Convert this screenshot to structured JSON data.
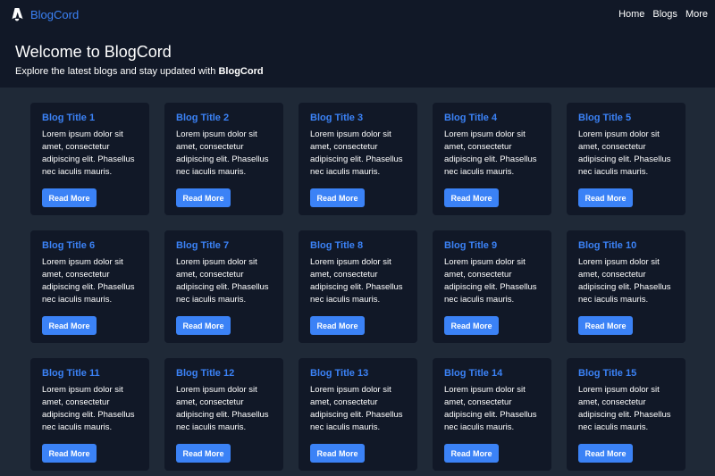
{
  "nav": {
    "brand": "BlogCord",
    "links": [
      "Home",
      "Blogs",
      "More"
    ]
  },
  "hero": {
    "title": "Welcome to BlogCord",
    "subtitle_prefix": "Explore the latest blogs and stay updated with ",
    "subtitle_brand": "BlogCord"
  },
  "cards": [
    {
      "title": "Blog Title 1",
      "excerpt": "Lorem ipsum dolor sit amet, consectetur adipiscing elit. Phasellus nec iaculis mauris.",
      "button": "Read More"
    },
    {
      "title": "Blog Title 2",
      "excerpt": "Lorem ipsum dolor sit amet, consectetur adipiscing elit. Phasellus nec iaculis mauris.",
      "button": "Read More"
    },
    {
      "title": "Blog Title 3",
      "excerpt": "Lorem ipsum dolor sit amet, consectetur adipiscing elit. Phasellus nec iaculis mauris.",
      "button": "Read More"
    },
    {
      "title": "Blog Title 4",
      "excerpt": "Lorem ipsum dolor sit amet, consectetur adipiscing elit. Phasellus nec iaculis mauris.",
      "button": "Read More"
    },
    {
      "title": "Blog Title 5",
      "excerpt": "Lorem ipsum dolor sit amet, consectetur adipiscing elit. Phasellus nec iaculis mauris.",
      "button": "Read More"
    },
    {
      "title": "Blog Title 6",
      "excerpt": "Lorem ipsum dolor sit amet, consectetur adipiscing elit. Phasellus nec iaculis mauris.",
      "button": "Read More"
    },
    {
      "title": "Blog Title 7",
      "excerpt": "Lorem ipsum dolor sit amet, consectetur adipiscing elit. Phasellus nec iaculis mauris.",
      "button": "Read More"
    },
    {
      "title": "Blog Title 8",
      "excerpt": "Lorem ipsum dolor sit amet, consectetur adipiscing elit. Phasellus nec iaculis mauris.",
      "button": "Read More"
    },
    {
      "title": "Blog Title 9",
      "excerpt": "Lorem ipsum dolor sit amet, consectetur adipiscing elit. Phasellus nec iaculis mauris.",
      "button": "Read More"
    },
    {
      "title": "Blog Title 10",
      "excerpt": "Lorem ipsum dolor sit amet, consectetur adipiscing elit. Phasellus nec iaculis mauris.",
      "button": "Read More"
    },
    {
      "title": "Blog Title 11",
      "excerpt": "Lorem ipsum dolor sit amet, consectetur adipiscing elit. Phasellus nec iaculis mauris.",
      "button": "Read More"
    },
    {
      "title": "Blog Title 12",
      "excerpt": "Lorem ipsum dolor sit amet, consectetur adipiscing elit. Phasellus nec iaculis mauris.",
      "button": "Read More"
    },
    {
      "title": "Blog Title 13",
      "excerpt": "Lorem ipsum dolor sit amet, consectetur adipiscing elit. Phasellus nec iaculis mauris.",
      "button": "Read More"
    },
    {
      "title": "Blog Title 14",
      "excerpt": "Lorem ipsum dolor sit amet, consectetur adipiscing elit. Phasellus nec iaculis mauris.",
      "button": "Read More"
    },
    {
      "title": "Blog Title 15",
      "excerpt": "Lorem ipsum dolor sit amet, consectetur adipiscing elit. Phasellus nec iaculis mauris.",
      "button": "Read More"
    }
  ],
  "theme": {
    "accent": "#3b82f6",
    "header_bg": "#111827",
    "page_bg": "#1f2937",
    "card_bg": "#111827"
  },
  "icons": {
    "logo": "astro-logo-icon"
  }
}
